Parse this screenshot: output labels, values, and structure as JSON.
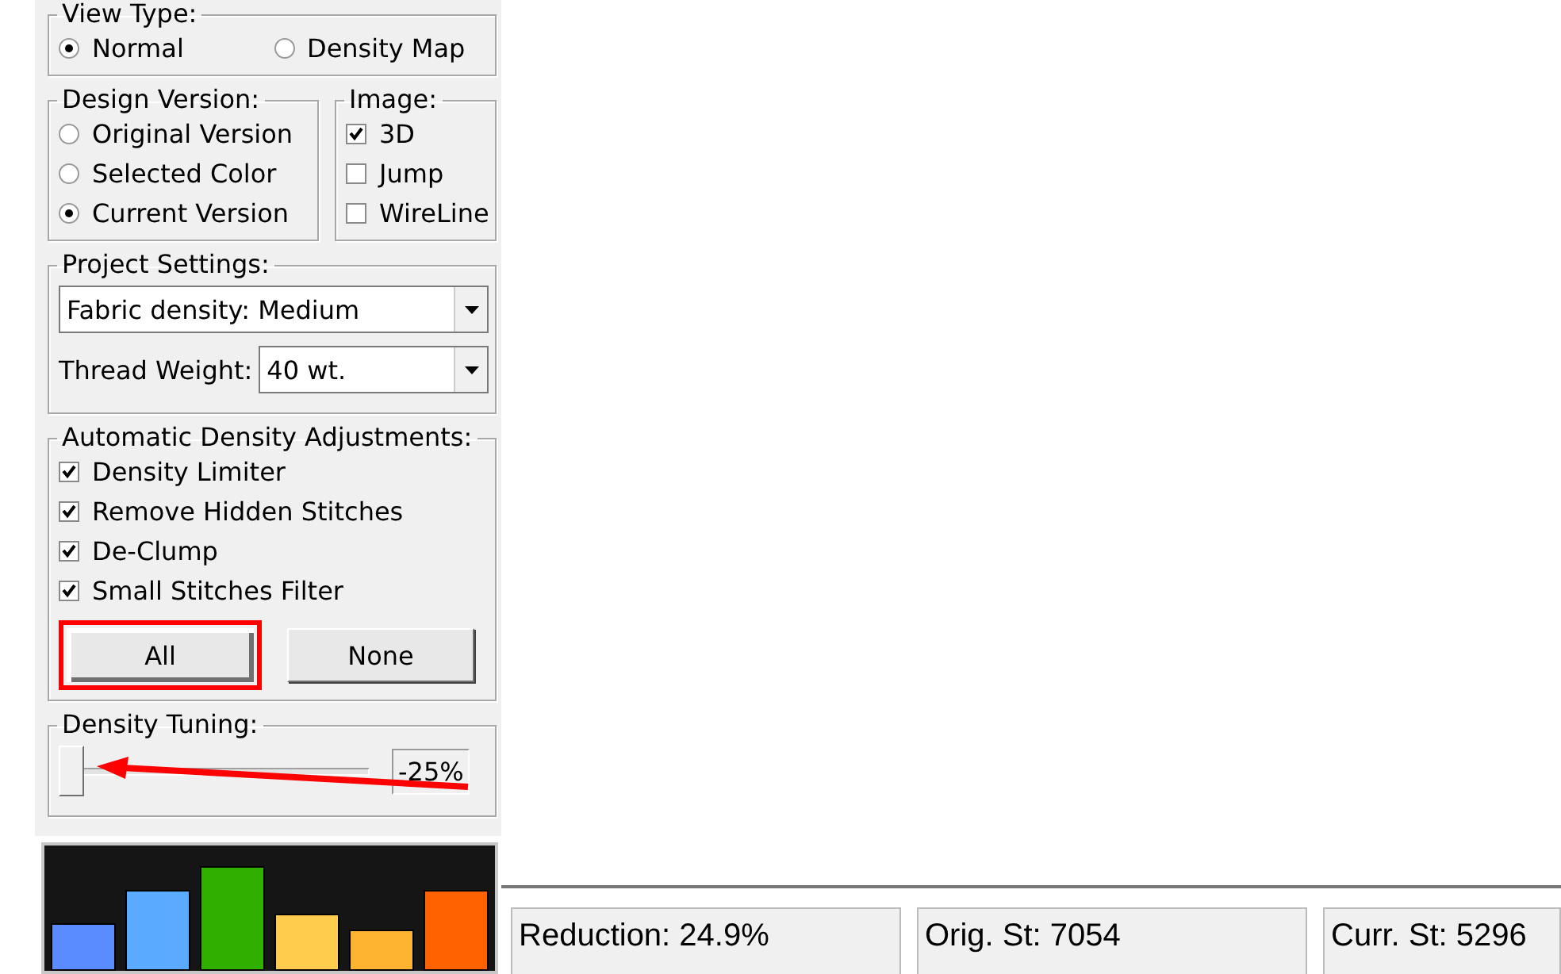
{
  "view_type": {
    "title": "View Type:",
    "options": [
      {
        "label": "Normal",
        "selected": true
      },
      {
        "label": "Density Map",
        "selected": false
      }
    ]
  },
  "design_version": {
    "title": "Design Version:",
    "options": [
      {
        "label": "Original Version",
        "selected": false
      },
      {
        "label": "Selected Color",
        "selected": false
      },
      {
        "label": "Current Version",
        "selected": true
      }
    ]
  },
  "image": {
    "title": "Image:",
    "options": [
      {
        "label": "3D",
        "checked": true
      },
      {
        "label": "Jump",
        "checked": false
      },
      {
        "label": "WireLine",
        "checked": false
      }
    ]
  },
  "project_settings": {
    "title": "Project Settings:",
    "fabric_density": {
      "value": "Fabric density: Medium"
    },
    "thread_weight": {
      "label": "Thread Weight:",
      "value": "40 wt."
    }
  },
  "automatic_density_adjustments": {
    "title": "Automatic Density Adjustments:",
    "options": [
      {
        "label": "Density Limiter",
        "checked": true
      },
      {
        "label": "Remove Hidden Stitches",
        "checked": true
      },
      {
        "label": "De-Clump",
        "checked": true
      },
      {
        "label": "Small Stitches Filter",
        "checked": true
      }
    ],
    "buttons": [
      {
        "label": "All",
        "highlighted": true
      },
      {
        "label": "None",
        "highlighted": false
      }
    ]
  },
  "density_tuning": {
    "title": "Density Tuning:",
    "level": 0,
    "reading": "-25%"
  },
  "status_bar": [
    "Reduction: 24.9%",
    "Orig. St: 7054",
    "Curr. St: 5296"
  ]
}
